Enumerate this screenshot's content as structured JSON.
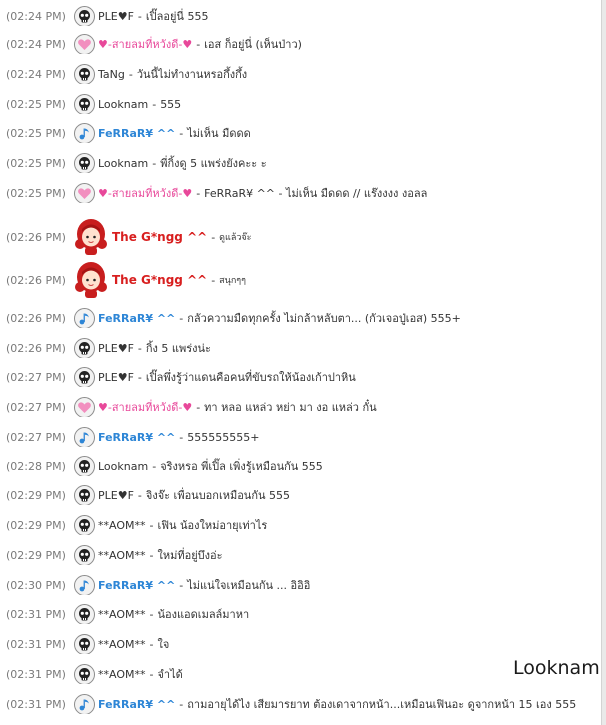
{
  "colors": {
    "time": "#7a7a7a",
    "black_name": "#333333",
    "pink_name": "#e8489a",
    "blue_name": "#2e86d6",
    "red_name": "#d81f1f"
  },
  "overlay_label": "Looknam",
  "messages": [
    {
      "time": "(02:24 PM)",
      "icon": "skull-icon",
      "name": "PLE♥F",
      "style": "black",
      "text": "เปิ๊ลอยู่นี่ 555"
    },
    {
      "time": "(02:24 PM)",
      "icon": "heart-icon",
      "name": "♥-สายลมที่หวังดี-♥",
      "style": "pink",
      "text": "เอส ก็อยู่นี่ (เห็นป่าว)"
    },
    {
      "time": "(02:24 PM)",
      "icon": "skull-icon",
      "name": "TaNg",
      "style": "black",
      "text": "วันนี้ไม่ทำงานหรอกึ้งกึ้ง"
    },
    {
      "time": "(02:25 PM)",
      "icon": "skull-icon",
      "name": "Looknam",
      "style": "black",
      "text": "555"
    },
    {
      "time": "(02:25 PM)",
      "icon": "music-note-icon",
      "name": "FeRRaR¥ ^^",
      "style": "blue",
      "text": "ไม่เห็น มืดดด"
    },
    {
      "time": "(02:25 PM)",
      "icon": "skull-icon",
      "name": "Looknam",
      "style": "black",
      "text": "พี่กิ้งดู 5 แพร่งยังคะะ ะ"
    },
    {
      "time": "(02:25 PM)",
      "icon": "heart-icon",
      "name": "♥-สายลมที่หวังดี-♥",
      "style": "pink",
      "text": "FeRRaR¥ ^^ - ไม่เห็น มืดดด // แร๊งงงง งอลล"
    },
    {
      "time": "(02:26 PM)",
      "icon": "girl-avatar-icon",
      "name": "The G*ngg ^^",
      "style": "red",
      "text": "ดูแล้วจ๊ะ",
      "small": true
    },
    {
      "time": "(02:26 PM)",
      "icon": "girl-avatar-icon",
      "name": "The G*ngg ^^",
      "style": "red",
      "text": "สนุกๆๆ",
      "small": true
    },
    {
      "time": "(02:26 PM)",
      "icon": "music-note-icon",
      "name": "FeRRaR¥ ^^",
      "style": "blue",
      "text": "กลัวความมืดทุกครั้ง ไม่กล้าหลับตา... (กัวเจอปู่เอส) 555+"
    },
    {
      "time": "(02:26 PM)",
      "icon": "skull-icon",
      "name": "PLE♥F",
      "style": "black",
      "text": "กิ้ง 5 แพร่งน่ะ"
    },
    {
      "time": "(02:27 PM)",
      "icon": "skull-icon",
      "name": "PLE♥F",
      "style": "black",
      "text": "เปิ๊ลพึ่งรู้ว่าแดนคือคนที่ขับรถให้น้องเก้าปาหิน"
    },
    {
      "time": "(02:27 PM)",
      "icon": "heart-icon",
      "name": "♥-สายลมที่หวังดี-♥",
      "style": "pink",
      "text": "ทา หลอ แหล่ว หย่า มา งอ แหล่ว กั๋น"
    },
    {
      "time": "(02:27 PM)",
      "icon": "music-note-icon",
      "name": "FeRRaR¥ ^^",
      "style": "blue",
      "text": "555555555+"
    },
    {
      "time": "(02:28 PM)",
      "icon": "skull-icon",
      "name": "Looknam",
      "style": "black",
      "text": "จริงหรอ พี่เปิ๊ล เพิ่งรู้เหมือนกัน 555"
    },
    {
      "time": "(02:29 PM)",
      "icon": "skull-icon",
      "name": "PLE♥F",
      "style": "black",
      "text": "จิงจ๊ะ เพื่อนบอกเหมือนกัน 555"
    },
    {
      "time": "(02:29 PM)",
      "icon": "skull-icon",
      "name": "**AOM**",
      "style": "black",
      "text": "เฟิน น้องใหม่อายุเท่าไร"
    },
    {
      "time": "(02:29 PM)",
      "icon": "skull-icon",
      "name": "**AOM**",
      "style": "black",
      "text": "ใหม่ที่อยู่บึงอ่ะ"
    },
    {
      "time": "(02:30 PM)",
      "icon": "music-note-icon",
      "name": "FeRRaR¥ ^^",
      "style": "blue",
      "text": "ไม่แน่ใจเหมือนกัน ... อิอิอิ"
    },
    {
      "time": "(02:31 PM)",
      "icon": "skull-icon",
      "name": "**AOM**",
      "style": "black",
      "text": "น้องแอดเมลล์มาหา"
    },
    {
      "time": "(02:31 PM)",
      "icon": "skull-icon",
      "name": "**AOM**",
      "style": "black",
      "text": "ใจ"
    },
    {
      "time": "(02:31 PM)",
      "icon": "skull-icon",
      "name": "**AOM**",
      "style": "black",
      "text": "จำได้"
    },
    {
      "time": "(02:31 PM)",
      "icon": "music-note-icon",
      "name": "FeRRaR¥ ^^",
      "style": "blue",
      "text": "ถามอายุได้ไง เสียมารยาท ต้องเดาจากหน้า...เหมือนเฟินอะ ดูจากหน้า 15 เอง 555"
    }
  ]
}
